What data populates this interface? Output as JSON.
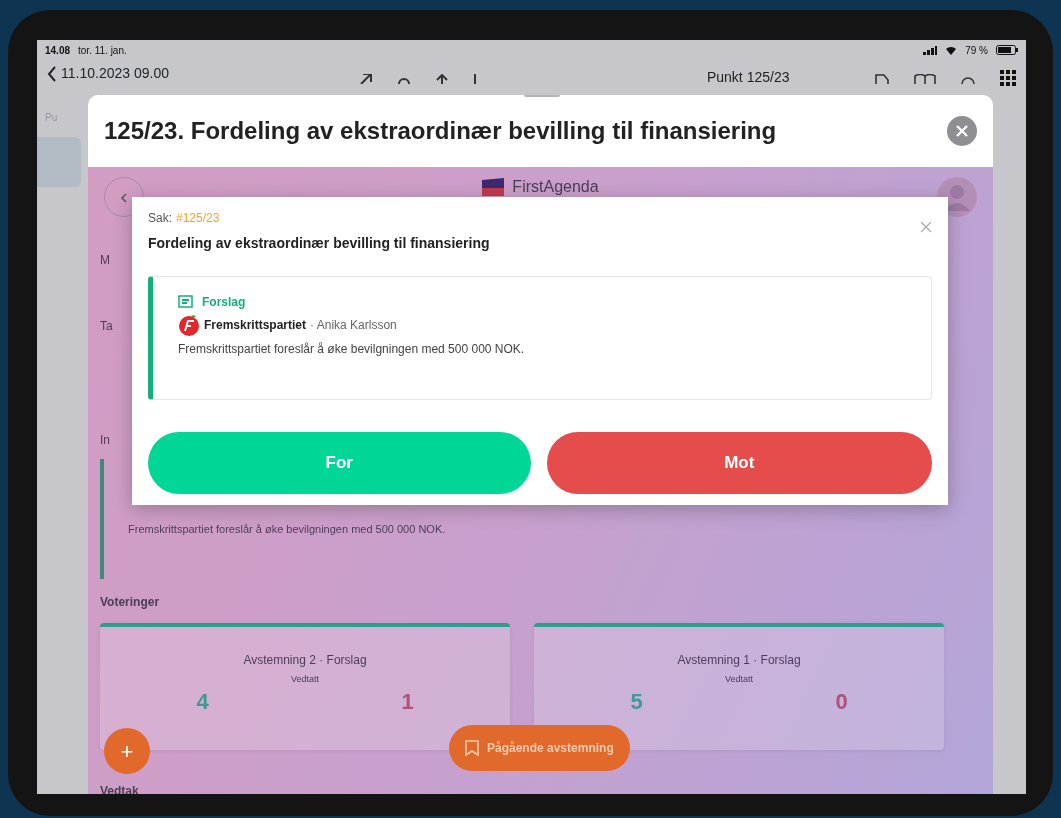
{
  "status_bar": {
    "time": "14.08",
    "date": "tor. 11. jan.",
    "battery": "79 %"
  },
  "nav": {
    "back_label": "11.10.2023 09.00",
    "title": "Punkt 125/23"
  },
  "sidebar": {
    "label": "Pu"
  },
  "sheet": {
    "title": "125/23. Fordeling av ekstraordinær bevilling til finansiering"
  },
  "app": {
    "brand": "FirstAgenda",
    "section_labels": [
      "M",
      "Ta",
      "In"
    ],
    "proposal_text": "Fremskrittspartiet foreslår å øke bevilgningen med 500 000 NOK.",
    "votes_heading": "Voteringer",
    "votes": [
      {
        "title": "Avstemning 2 · Forslag",
        "result": "Vedtatt",
        "for": "4",
        "against": "1"
      },
      {
        "title": "Avstemning 1 · Forslag",
        "result": "Vedtatt",
        "for": "5",
        "against": "0"
      }
    ],
    "decision_heading": "Vedtak",
    "fab_label": "+",
    "ongoing_button": "Pågående avstemning"
  },
  "dialog": {
    "case_label": "Sak:",
    "case_number": "#125/23",
    "title": "Fordeling av ekstraordinær bevilling til finansiering",
    "proposal": {
      "kind_label": "Forslag",
      "party": "Fremskrittspartiet",
      "author": "· Anika Karlsson",
      "text": "Fremskrittspartiet foreslår å øke bevilgningen med 500 000 NOK."
    },
    "buttons": [
      {
        "label": "For",
        "kind": "for"
      },
      {
        "label": "Mot",
        "kind": "against"
      }
    ]
  }
}
